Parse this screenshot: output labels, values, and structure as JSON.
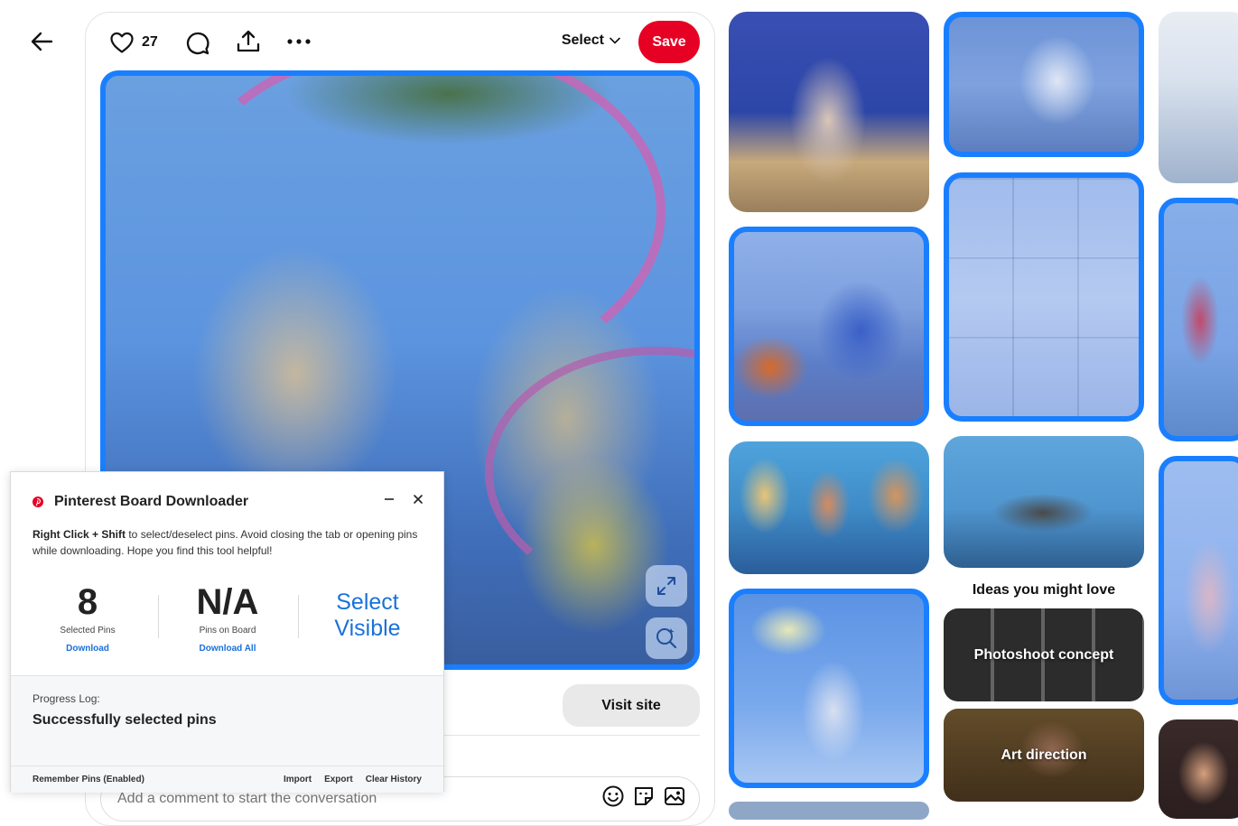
{
  "pin": {
    "like_count": "27",
    "select_label": "Select",
    "save_label": "Save",
    "visit_label": "Visit site",
    "comment_placeholder": "Add a comment to start the conversation"
  },
  "ideas": {
    "heading": "Ideas you might love",
    "items": [
      {
        "label": "Photoshoot concept"
      },
      {
        "label": "Art direction"
      }
    ]
  },
  "extension": {
    "title": "Pinterest Board Downloader",
    "instructions_bold": "Right Click + Shift",
    "instructions_rest": " to select/deselect pins. Avoid closing the tab or opening pins while downloading. Hope you find this tool helpful!",
    "selected_count": "8",
    "selected_label": "Selected Pins",
    "download_label": "Download",
    "board_count": "N/A",
    "board_label": "Pins on Board",
    "download_all_label": "Download All",
    "select_visible_label": "Select Visible",
    "progress_label": "Progress Log:",
    "progress_message": "Successfully selected pins",
    "remember_label": "Remember Pins (Enabled)",
    "import_label": "Import",
    "export_label": "Export",
    "clear_label": "Clear History"
  },
  "colors": {
    "save_red": "#e60023",
    "selection_blue": "#1a7fff",
    "link_blue": "#1a6fd8"
  },
  "icons": [
    "back-arrow-icon",
    "heart-icon",
    "comment-icon",
    "share-icon",
    "more-icon",
    "chevron-down-icon",
    "expand-icon",
    "visual-search-icon",
    "emoji-icon",
    "sticker-icon",
    "image-icon",
    "pinterest-logo-icon",
    "minimize-icon",
    "close-icon"
  ]
}
